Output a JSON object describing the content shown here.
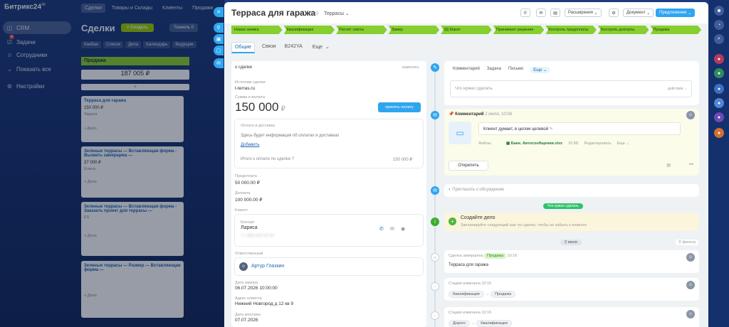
{
  "app": {
    "name": "Битрикс24",
    "version": "26"
  },
  "left_menu": [
    {
      "label": "CRM",
      "icon": "crm-icon",
      "active": true
    },
    {
      "label": "Задачи",
      "icon": "tasks-icon",
      "badge": "4"
    },
    {
      "label": "Сотрудники",
      "icon": "people-icon"
    },
    {
      "label": "Показать все",
      "icon": "chevron-down-icon"
    },
    {
      "label": "Настройки",
      "icon": "gear-icon"
    }
  ],
  "top_nav": {
    "tabs": [
      "Сделки",
      "Товары и Склады",
      "Клиенты",
      "Продажи"
    ],
    "badges": [
      "1",
      "",
      "1",
      ""
    ]
  },
  "crm": {
    "title": "Сделки",
    "create": "Создать",
    "funnel": "Тоннель",
    "funnel_badge": "0",
    "views": [
      "Канбан",
      "Список",
      "Дела",
      "Календарь",
      "Ведущие"
    ],
    "stage_name": "Продажа",
    "stage_sum": "187 005 ₽",
    "add": "+",
    "cards": [
      {
        "title": "Терраса для гаража",
        "sum": "150 000 ₽",
        "client": "Лариса",
        "meta": "+ Дело"
      },
      {
        "title": "Зеленые террасы — Вставляющая форма - Вызвать замерщика —",
        "sum": "37 000 ₽",
        "client": "Елена",
        "meta": "+ Дело"
      },
      {
        "title": "Зеленые террасы — Вставляющая форма - Заказать проект для террасы —",
        "sum": "",
        "client": "ES",
        "meta": "+ Дело"
      },
      {
        "title": "Зеленые террасы — Размер — Вставляющая форма —",
        "sum": "",
        "client": "",
        "meta": "+ Дело"
      }
    ]
  },
  "deal": {
    "title": "Терраса для гаража",
    "category": "Террасы",
    "toolbar": {
      "expand": "Расширения",
      "document": "Документ",
      "offer": "Предложение"
    },
    "stages": [
      "Новая заявка",
      "Квалификация",
      "Расчёт сметы",
      "Замер",
      "3Д Макет",
      "Принимает решение",
      "Контроль предоплаты",
      "Контроль доплаты",
      "Продажа"
    ],
    "tabs": [
      "Общие",
      "Связи",
      "B242YA",
      "Еще"
    ],
    "about": {
      "title": "о сделке",
      "edit": "изменить"
    },
    "source_label": "Источник сделки",
    "source": "t-terras.ru",
    "amount_label": "Сумма и валюта",
    "amount": "150 000",
    "currency": "₽",
    "pay_button": "принять оплату",
    "payment": {
      "title": "Оплата и доставка",
      "hint": "Здесь будет информация об оплатах и доставках",
      "add": "Добавить",
      "total_label": "Итого к оплате по сделке",
      "total": "150 000 ₽"
    },
    "prepay_label": "Предоплата",
    "prepay": "50 000.00 ₽",
    "extra_label": "Доплата",
    "extra": "100 000.00 ₽",
    "client_label": "Клиент",
    "contact_label": "Контакт",
    "contact_name": "Лариса",
    "contact_phone": "+7 999 000 00 00",
    "responsible_label": "Ответственный",
    "responsible": "Артур Глазкин",
    "measure_date_label": "Дата замера",
    "measure_date": "06.07.2026 10:00:00",
    "address_label": "Адрес клиента",
    "address": "Нижний Новгород д 12 кв 9",
    "mount_date_label": "Дата монтажа",
    "mount_date": "07.07.2026"
  },
  "timeline": {
    "tabs": [
      "Комментарий",
      "Задача",
      "Письмо",
      "Еще"
    ],
    "input_placeholder": "Что нужно сделать",
    "actions": "действия",
    "comment": {
      "title": "Комментарий",
      "date": "2 июля, 10:06",
      "text": "Клиент думает, в целом целевой",
      "files_label": "Файлы:",
      "file": "Банк. Автосообщения.xlsx",
      "file_size": "10 КБ",
      "edit": "Редактировать",
      "more": "Еще",
      "pin": "Открепить"
    },
    "discuss_placeholder": "Пригласить к обсуждению",
    "todo_badge": "Что нужно сделать",
    "create": {
      "title": "Создайте дело",
      "hint": "Запланируйте следующий шаг по сделке, чтобы не забыть о клиенте"
    },
    "date_sep": "2 июля",
    "filter": "фильтр",
    "events": [
      {
        "title": "Сделка завершена",
        "tag": "Продажа",
        "time": "10:16",
        "text": "Терраса для гаража"
      },
      {
        "title": "Стадия изменена",
        "time": "10:16",
        "from": "Квалификация",
        "to": "Продажа"
      },
      {
        "title": "Стадия изменена",
        "time": "10:16",
        "from": "Дорого",
        "to": "Квалификация"
      }
    ]
  },
  "colors": {
    "stage": "#86cf2f",
    "accent": "#2fa5f0",
    "bg": "#1c3a7c"
  }
}
